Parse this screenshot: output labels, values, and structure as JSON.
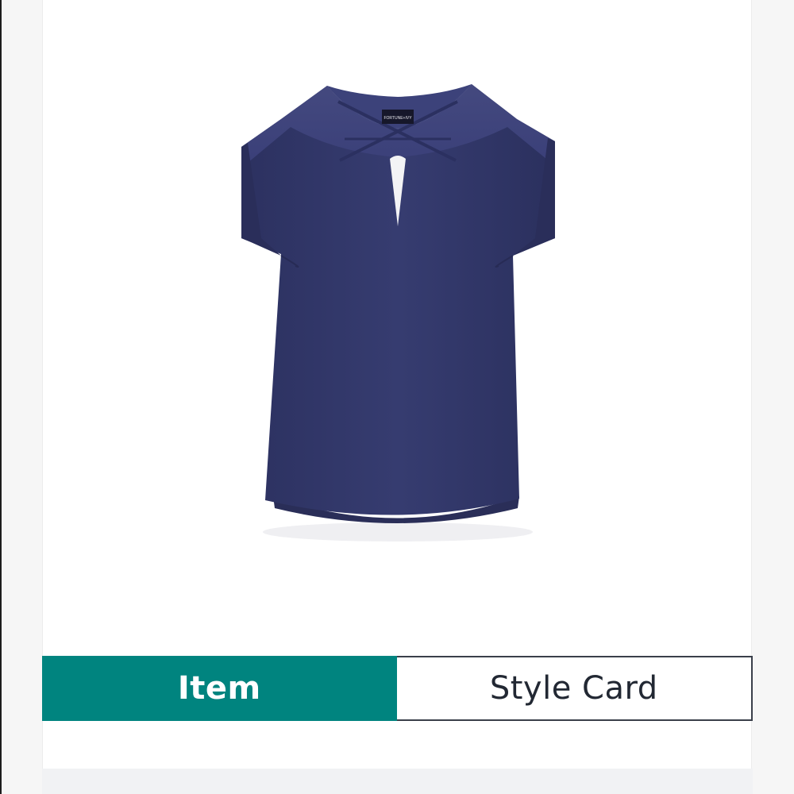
{
  "product": {
    "image_icon": "sleeveless-blouse-icon",
    "garment_color": "#343a6b",
    "brand_tag": "FORTUNE+IVY"
  },
  "view_toggle": {
    "item_label": "Item",
    "style_card_label": "Style Card",
    "selected": "item",
    "accent_color": "#00847f"
  }
}
